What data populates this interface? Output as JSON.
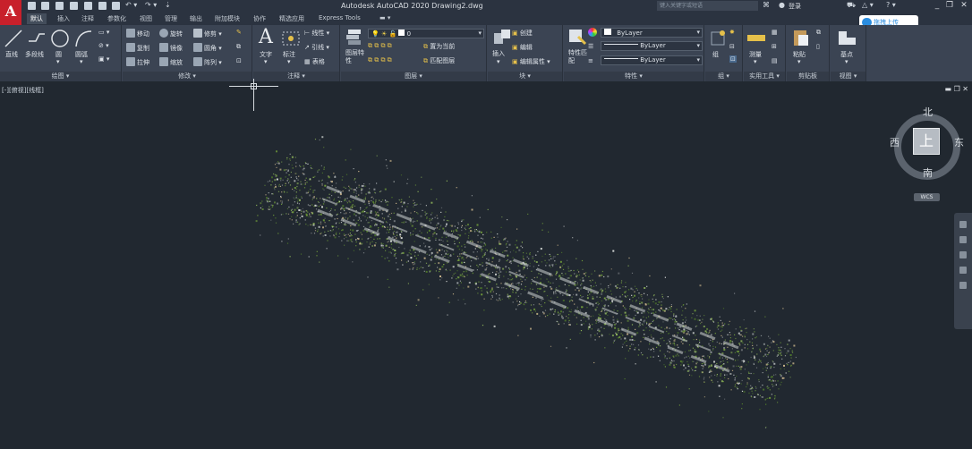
{
  "app": {
    "logo_letter": "A",
    "title": "Autodesk AutoCAD 2020    Drawing2.dwg",
    "search_placeholder": "键入关键字或短语",
    "login_label": "登录",
    "help_label": "?",
    "upload_button": "拖拽上传"
  },
  "tabs": [
    {
      "label": "默认",
      "active": true
    },
    {
      "label": "插入"
    },
    {
      "label": "注释"
    },
    {
      "label": "参数化"
    },
    {
      "label": "视图"
    },
    {
      "label": "管理"
    },
    {
      "label": "输出"
    },
    {
      "label": "附加模块"
    },
    {
      "label": "协作"
    },
    {
      "label": "精选应用"
    },
    {
      "label": "Express Tools"
    }
  ],
  "ribbon": {
    "draw": {
      "title": "绘图",
      "line": "直线",
      "polyline": "多段线",
      "circle": "圆",
      "arc": "圆弧"
    },
    "modify": {
      "title": "修改",
      "move": "移动",
      "rotate": "旋转",
      "trim": "修剪",
      "copy": "复制",
      "mirror": "镜像",
      "fillet": "圆角",
      "stretch": "拉伸",
      "scale": "缩放",
      "array": "阵列"
    },
    "annotation": {
      "title": "注释",
      "text": "文字",
      "dimension": "标注",
      "linear": "线性",
      "leader": "引线",
      "table": "表格"
    },
    "layers": {
      "title": "图层",
      "layer_properties": "图层特性",
      "layer_value": "0",
      "make_current": "置为当前",
      "match_layer": "匹配图层"
    },
    "block": {
      "title": "块",
      "insert": "插入",
      "create": "创建",
      "edit": "编辑",
      "edit_attributes": "编辑属性"
    },
    "properties": {
      "title": "特性",
      "match": "特性匹配",
      "color": "ByLayer",
      "linetype": "ByLayer",
      "lineweight": "ByLayer"
    },
    "groups": {
      "title": "组",
      "group": "组"
    },
    "utilities": {
      "title": "实用工具",
      "measure": "测量"
    },
    "clipboard": {
      "title": "剪贴板",
      "paste": "粘贴"
    },
    "view": {
      "title": "视图",
      "base": "基点"
    }
  },
  "viewport": {
    "label": "[-][俯视][线框]",
    "controls": "▬  ❐  ✕"
  },
  "viewcube": {
    "face": "上",
    "north": "北",
    "south": "南",
    "east": "东",
    "west": "西",
    "wcs": "WCS"
  },
  "colors": {
    "background": "#212830",
    "ribbon": "#3b4453",
    "accent": "#c8202b",
    "point_green": "#6f9a3a",
    "point_white": "#d8dcd8"
  }
}
